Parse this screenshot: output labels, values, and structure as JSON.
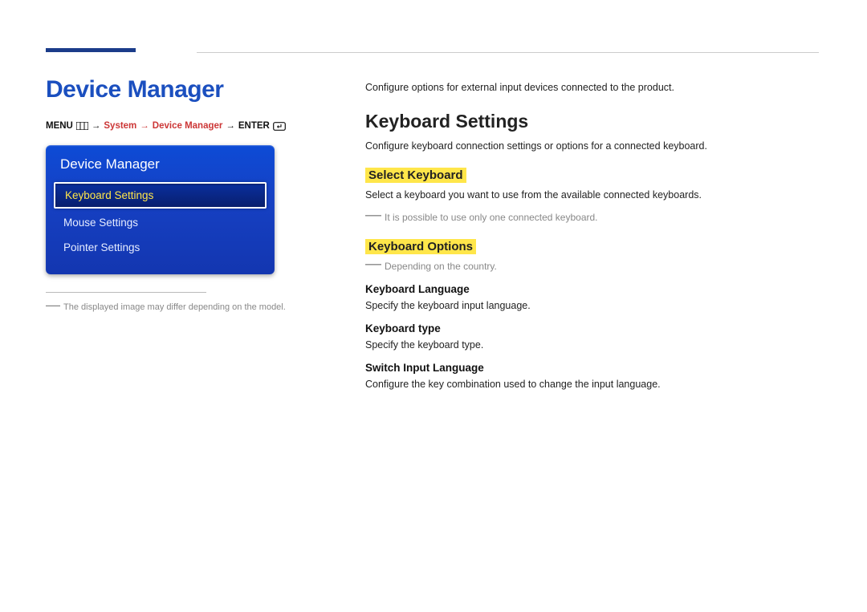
{
  "page": {
    "title": "Device Manager"
  },
  "breadcrumb": {
    "menu_label": "MENU",
    "arrow": "→",
    "path": [
      "System",
      "Device Manager"
    ],
    "enter_label": "ENTER"
  },
  "panel": {
    "title": "Device Manager",
    "items": [
      {
        "label": "Keyboard Settings",
        "selected": true
      },
      {
        "label": "Mouse Settings",
        "selected": false
      },
      {
        "label": "Pointer Settings",
        "selected": false
      }
    ]
  },
  "left_note": "The displayed image may differ depending on the model.",
  "content": {
    "intro": "Configure options for external input devices connected to the product.",
    "section_title": "Keyboard Settings",
    "section_desc": "Configure keyboard connection settings or options for a connected keyboard.",
    "select_keyboard": {
      "heading": "Select Keyboard",
      "desc": "Select a keyboard you want to use from the available connected keyboards.",
      "note": "It is possible to use only one connected keyboard."
    },
    "keyboard_options": {
      "heading": "Keyboard Options",
      "note": "Depending on the country.",
      "items": [
        {
          "title": "Keyboard Language",
          "desc": "Specify the keyboard input language."
        },
        {
          "title": "Keyboard type",
          "desc": "Specify the keyboard type."
        },
        {
          "title": "Switch Input Language",
          "desc": "Configure the key combination used to change the input language."
        }
      ]
    }
  }
}
